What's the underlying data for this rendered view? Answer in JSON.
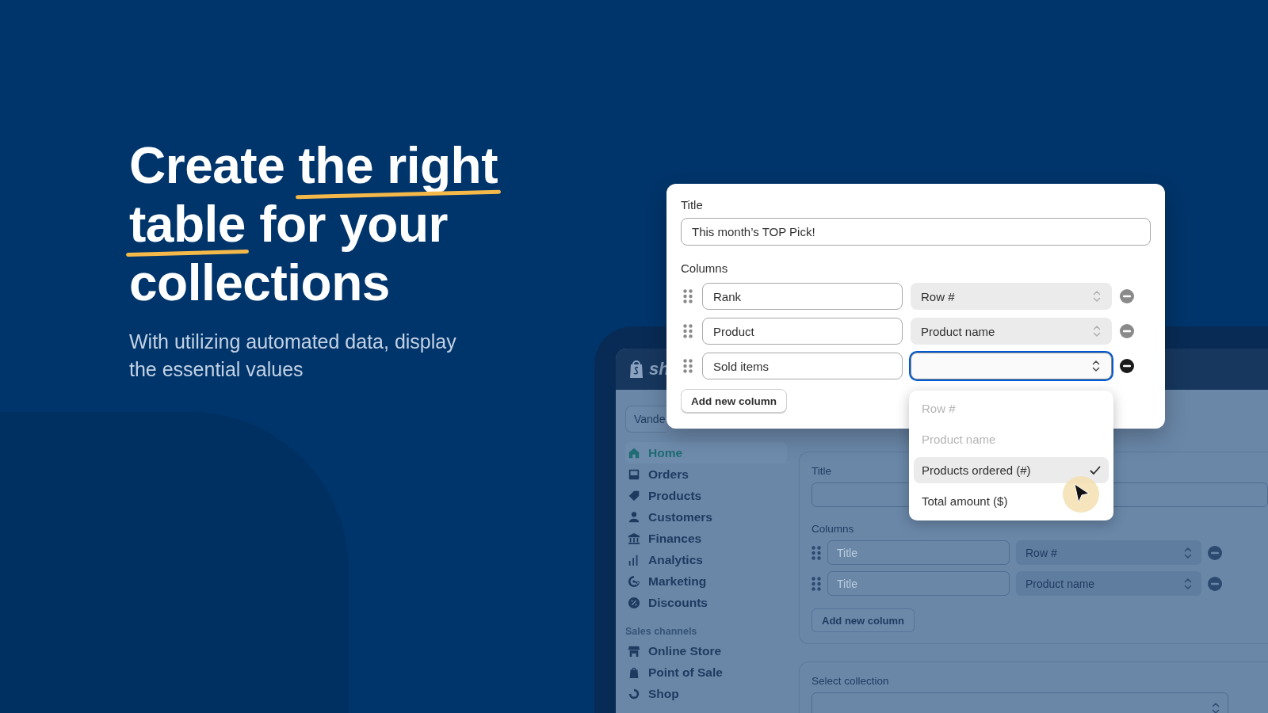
{
  "headline": {
    "lines": [
      [
        {
          "text": "Create ",
          "underline": false
        },
        {
          "text": "the right",
          "underline": true
        }
      ],
      [
        {
          "text": "table",
          "underline": true
        },
        {
          "text": " for your",
          "underline": false
        }
      ],
      [
        {
          "text": "collections",
          "underline": false
        }
      ]
    ]
  },
  "subtitle": "With utilizing automated data, display the essential values",
  "background_app": {
    "logo_text": "sh",
    "store_selector": "Vande",
    "sidebar": {
      "items": [
        {
          "label": "Home",
          "selected": true
        },
        {
          "label": "Orders",
          "selected": false
        },
        {
          "label": "Products",
          "selected": false
        },
        {
          "label": "Customers",
          "selected": false
        },
        {
          "label": "Finances",
          "selected": false
        },
        {
          "label": "Analytics",
          "selected": false
        },
        {
          "label": "Marketing",
          "selected": false
        },
        {
          "label": "Discounts",
          "selected": false
        }
      ],
      "section_title": "Sales channels",
      "channel_items": [
        {
          "label": "Online Store",
          "selected": false
        },
        {
          "label": "Point of Sale",
          "selected": false
        },
        {
          "label": "Shop",
          "selected": false
        }
      ]
    },
    "form": {
      "title_label": "Title",
      "columns_label": "Columns",
      "columns": [
        {
          "placeholder": "Title",
          "source": "Row #"
        },
        {
          "placeholder": "Title",
          "source": "Product name"
        }
      ],
      "add_button": "Add new column",
      "collection_label": "Select collection"
    }
  },
  "editor": {
    "title_label": "Title",
    "title_value": "This month’s TOP Pick!",
    "columns_label": "Columns",
    "columns": [
      {
        "name": "Rank",
        "source": "Row #",
        "active": false
      },
      {
        "name": "Product",
        "source": "Product name",
        "active": false
      },
      {
        "name": "Sold items",
        "active": true
      }
    ],
    "add_button": "Add new column",
    "dropdown": {
      "options": [
        {
          "label": "Row #",
          "disabled": true,
          "selected": false
        },
        {
          "label": "Product name",
          "disabled": true,
          "selected": false
        },
        {
          "label": "Products ordered (#)",
          "disabled": false,
          "selected": true
        },
        {
          "label": "Total amount ($)",
          "disabled": false,
          "selected": false
        }
      ]
    }
  }
}
